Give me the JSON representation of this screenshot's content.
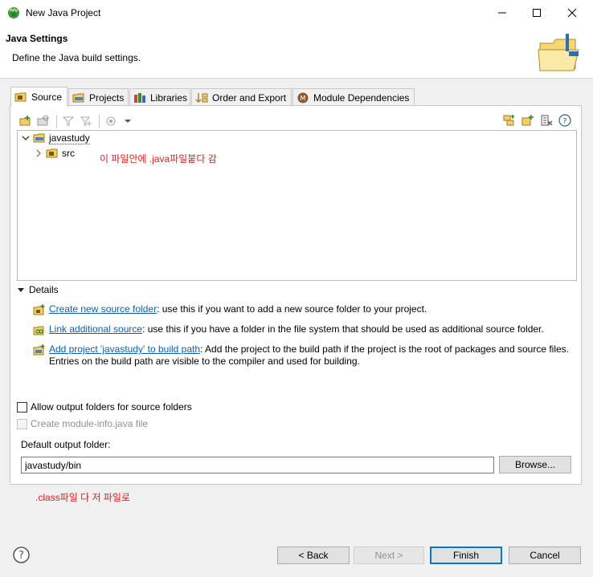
{
  "window": {
    "title": "New Java Project"
  },
  "banner": {
    "title": "Java Settings",
    "description": "Define the Java build settings."
  },
  "tabs": [
    {
      "label": "Source",
      "active": true
    },
    {
      "label": "Projects",
      "active": false
    },
    {
      "label": "Libraries",
      "active": false
    },
    {
      "label": "Order and Export",
      "active": false
    },
    {
      "label": "Module Dependencies",
      "active": false
    }
  ],
  "tree": {
    "project": "javastudy",
    "child": "src"
  },
  "annotations": {
    "note_src": "이 파일안에 .java파일붙다 감",
    "note_output": ".class파일 다 저 파일로"
  },
  "details": {
    "header": "Details",
    "items": [
      {
        "link": "Create new source folder",
        "text": ": use this if you want to add a new source folder to your project."
      },
      {
        "link": "Link additional source",
        "text": ": use this if you have a folder in the file system that should be used as additional source folder."
      },
      {
        "link": "Add project 'javastudy' to build path",
        "text": ": Add the project to the build path if the project is the root of packages and source files. Entries on the build path are visible to the compiler and used for building."
      }
    ]
  },
  "options": {
    "allow_output_folders": "Allow output folders for source folders",
    "create_module_info": "Create module-info.java file"
  },
  "output": {
    "label": "Default output folder:",
    "value": "javastudy/bin",
    "browse": "Browse..."
  },
  "footer": {
    "back": "< Back",
    "next": "Next >",
    "finish": "Finish",
    "cancel": "Cancel"
  },
  "colors": {
    "accent": "#0078d7",
    "link": "#0b5fb0",
    "annotation": "#e02020"
  }
}
